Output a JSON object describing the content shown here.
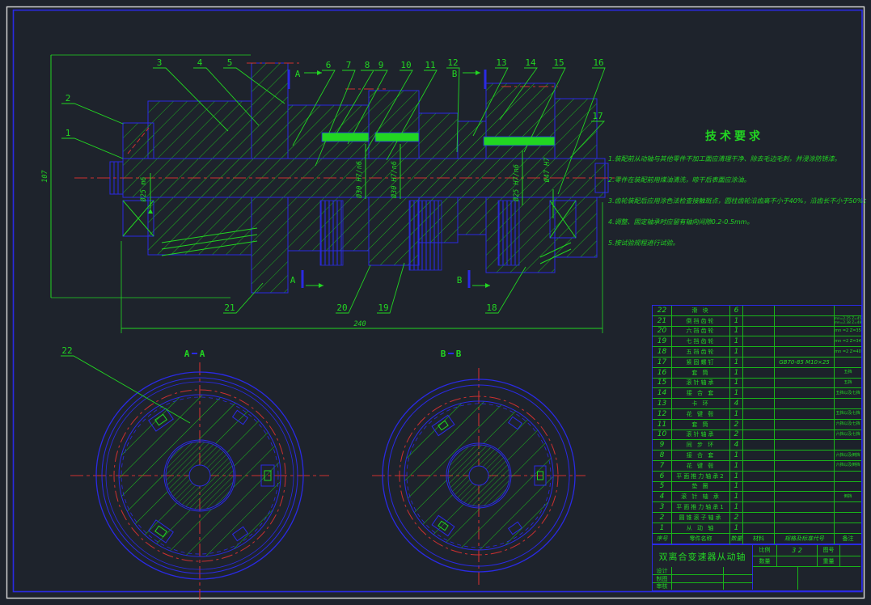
{
  "colors": {
    "background": "#1e232c",
    "green": "#22d522",
    "blue": "#2a2ae4",
    "red": "#cd3030",
    "white": "#e0e0e0"
  },
  "tech": {
    "title": "技术要求",
    "items": [
      "1.装配前从动轴与其他零件不加工面应清理干净、除去毛边毛刺，并浸涂防锈漆。",
      "2.零件在装配前用煤油清洗，晾干后表面应涂油。",
      "3.齿轮装配后应用涂色法检查接触斑点，圆柱齿轮沿齿高不小于40%，沿齿长不小于50%；",
      "4.调整、固定轴承时应留有轴向间隙0.2-0.5mm。",
      "5.按试验规程进行试验。"
    ]
  },
  "callouts": [
    "1",
    "2",
    "3",
    "4",
    "5",
    "6",
    "7",
    "8",
    "9",
    "10",
    "11",
    "12",
    "13",
    "14",
    "15",
    "16",
    "17",
    "18",
    "19",
    "20",
    "21",
    "22"
  ],
  "section_labels": {
    "a": "A",
    "b": "B"
  },
  "dims": {
    "length": "240",
    "height": "107",
    "d_left": "Ø25 m6",
    "d_mid1": "Ø30 H7/n6",
    "d_mid2": "Ø30 H7/n6",
    "d_mid3": "Ø25 H7/n6",
    "d_right": "Ø47 H7"
  },
  "bom": {
    "headers": [
      "序号",
      "零件名称",
      "数量",
      "材料",
      "规格及标准代号",
      "备注"
    ],
    "rows": [
      {
        "no": "22",
        "name": "滑 块",
        "qty": "6",
        "material": "",
        "spec": "",
        "remark": ""
      },
      {
        "no": "21",
        "name": "倒挡齿轮",
        "qty": "1",
        "material": "",
        "spec": "",
        "remark": "mn=2.25 Z=45",
        "remark2": "mn=2.38 Z=48"
      },
      {
        "no": "20",
        "name": "六挡齿轮",
        "qty": "1",
        "material": "",
        "spec": "",
        "remark": "mn =2 Z=35"
      },
      {
        "no": "19",
        "name": "七挡齿轮",
        "qty": "1",
        "material": "",
        "spec": "",
        "remark": "mn =2 Z=34"
      },
      {
        "no": "18",
        "name": "五挡齿轮",
        "qty": "1",
        "material": "",
        "spec": "",
        "remark": "mn =2 Z=40"
      },
      {
        "no": "17",
        "name": "紧固螺钉",
        "qty": "1",
        "material": "",
        "spec": "GB70-85 M10×25",
        "remark": ""
      },
      {
        "no": "16",
        "name": "套 筒",
        "qty": "1",
        "material": "",
        "spec": "",
        "remark": "五挡"
      },
      {
        "no": "15",
        "name": "滚针轴承",
        "qty": "1",
        "material": "",
        "spec": "",
        "remark": "五挡"
      },
      {
        "no": "14",
        "name": "接 合 套",
        "qty": "1",
        "material": "",
        "spec": "",
        "remark": "五挡以及七挡"
      },
      {
        "no": "13",
        "name": "卡 环",
        "qty": "4",
        "material": "",
        "spec": "",
        "remark": ""
      },
      {
        "no": "12",
        "name": "花 键 毂",
        "qty": "1",
        "material": "",
        "spec": "",
        "remark": "五挡以及七挡"
      },
      {
        "no": "11",
        "name": "套 筒",
        "qty": "2",
        "material": "",
        "spec": "",
        "remark": "六挡以及七挡"
      },
      {
        "no": "10",
        "name": "滚针轴承",
        "qty": "2",
        "material": "",
        "spec": "",
        "remark": "六挡以及七挡"
      },
      {
        "no": "9",
        "name": "同 步 环",
        "qty": "4",
        "material": "",
        "spec": "",
        "remark": ""
      },
      {
        "no": "8",
        "name": "接 合 套",
        "qty": "1",
        "material": "",
        "spec": "",
        "remark": "六挡以及倒挡"
      },
      {
        "no": "7",
        "name": "花 键 毂",
        "qty": "1",
        "material": "",
        "spec": "",
        "remark": "六挡以及倒挡"
      },
      {
        "no": "6",
        "name": "平面推力轴承2",
        "qty": "1",
        "material": "",
        "spec": "",
        "remark": ""
      },
      {
        "no": "5",
        "name": "垫 圈",
        "qty": "1",
        "material": "",
        "spec": "",
        "remark": ""
      },
      {
        "no": "4",
        "name": "滚 针 轴 承",
        "qty": "1",
        "material": "",
        "spec": "",
        "remark": "倒挡"
      },
      {
        "no": "3",
        "name": "平面推力轴承1",
        "qty": "1",
        "material": "",
        "spec": "",
        "remark": ""
      },
      {
        "no": "2",
        "name": "圆锥滚子轴承",
        "qty": "2",
        "material": "",
        "spec": "",
        "remark": ""
      },
      {
        "no": "1",
        "name": "从 动 轴",
        "qty": "1",
        "material": "",
        "spec": "",
        "remark": ""
      }
    ]
  },
  "title_block": {
    "part_name": "双离合变速器从动轴",
    "scale_label": "比例",
    "scale_value": "3 2",
    "qty_label": "数量",
    "qty_value": "",
    "figno_label": "图号",
    "figno_value": "",
    "weight_label": "重量",
    "weight_value": "",
    "sign_rows": [
      "设计",
      "制图",
      "审核"
    ]
  }
}
